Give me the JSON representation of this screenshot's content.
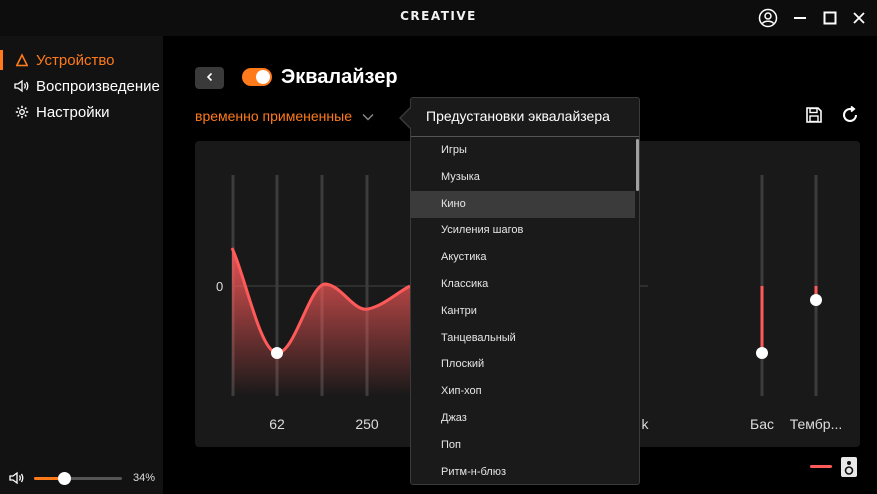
{
  "window": {
    "brand": "CREATIVE"
  },
  "sidebar": {
    "items": [
      {
        "label": "Устройство",
        "icon": "headphones-icon",
        "active": true
      },
      {
        "label": "Воспроизведение",
        "icon": "speaker-icon",
        "active": false
      },
      {
        "label": "Настройки",
        "icon": "gear-icon",
        "active": false
      }
    ],
    "volume": {
      "percent": 34,
      "label": "34%"
    }
  },
  "header": {
    "title": "Эквалайзер",
    "enabled": true
  },
  "preset": {
    "current": "временно примененные"
  },
  "equalizer": {
    "zero_label": "0",
    "band_labels": [
      "62",
      "250",
      "k"
    ],
    "extra_labels": [
      "Бас",
      "Тембр..."
    ],
    "accent": "#ff5a5a"
  },
  "presets_popup": {
    "title": "Предустановки эквалайзера",
    "items": [
      "Игры",
      "Музыка",
      "Кино",
      "Усиления шагов",
      "Акустика",
      "Классика",
      "Кантри",
      "Танцевальный",
      "Плоский",
      "Хип-хоп",
      "Джаз",
      "Поп",
      "Ритм-н-блюз"
    ],
    "selected": "Кино"
  },
  "colors": {
    "accent": "#ff7a1a",
    "curve": "#ff5a5a",
    "background": "#000000",
    "sidebar": "#121212",
    "panel": "#191919"
  }
}
